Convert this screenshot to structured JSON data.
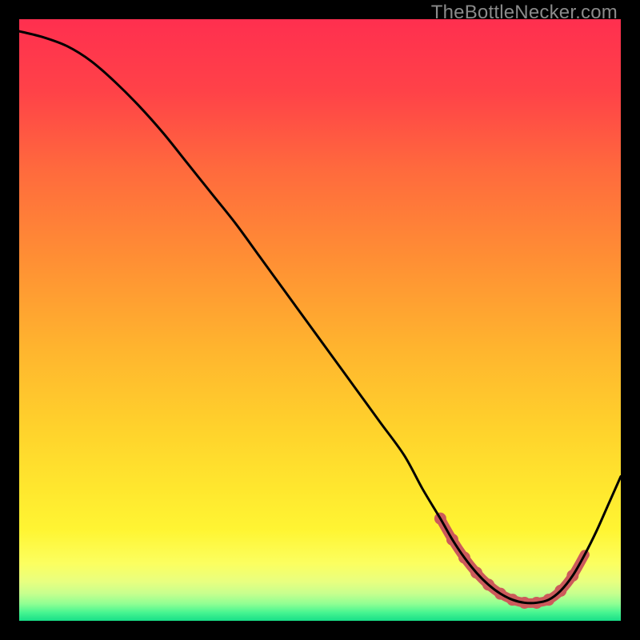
{
  "watermark": "TheBottleNecker.com",
  "colors": {
    "curve": "#000000",
    "marker": "#cc5a5b",
    "gradient_stops": [
      {
        "offset": 0.0,
        "c": "#ff2f4f"
      },
      {
        "offset": 0.12,
        "c": "#ff4248"
      },
      {
        "offset": 0.25,
        "c": "#ff6a3d"
      },
      {
        "offset": 0.4,
        "c": "#ff8f34"
      },
      {
        "offset": 0.55,
        "c": "#ffb52e"
      },
      {
        "offset": 0.68,
        "c": "#ffd22c"
      },
      {
        "offset": 0.78,
        "c": "#ffe72e"
      },
      {
        "offset": 0.85,
        "c": "#fff533"
      },
      {
        "offset": 0.905,
        "c": "#fcff60"
      },
      {
        "offset": 0.935,
        "c": "#e8ff80"
      },
      {
        "offset": 0.955,
        "c": "#c6ff8e"
      },
      {
        "offset": 0.972,
        "c": "#8fff93"
      },
      {
        "offset": 0.986,
        "c": "#48f591"
      },
      {
        "offset": 1.0,
        "c": "#18df88"
      }
    ]
  },
  "chart_data": {
    "type": "line",
    "title": "",
    "xlabel": "",
    "ylabel": "",
    "xlim": [
      0,
      100
    ],
    "ylim": [
      0,
      100
    ],
    "grid": false,
    "legend": false,
    "annotations": [],
    "x": [
      0,
      4,
      8,
      12,
      16,
      20,
      24,
      28,
      32,
      36,
      40,
      44,
      48,
      52,
      56,
      60,
      64,
      67,
      70,
      72,
      74,
      76,
      78,
      80,
      82,
      84,
      86,
      88,
      90,
      92,
      94,
      96,
      98,
      100
    ],
    "values": [
      98,
      97,
      95.5,
      93,
      89.5,
      85.5,
      81,
      76,
      71,
      66,
      60.5,
      55,
      49.5,
      44,
      38.5,
      33,
      27.5,
      22,
      17,
      13.5,
      10.5,
      8,
      6,
      4.5,
      3.5,
      3,
      3,
      3.5,
      5,
      7.5,
      11,
      15,
      19.5,
      24
    ],
    "marker_segment": {
      "start_index": 18,
      "end_index": 30
    },
    "marker_dots_x": [
      70,
      72,
      74,
      76,
      78,
      80,
      82,
      84,
      86,
      88,
      90,
      92
    ]
  }
}
